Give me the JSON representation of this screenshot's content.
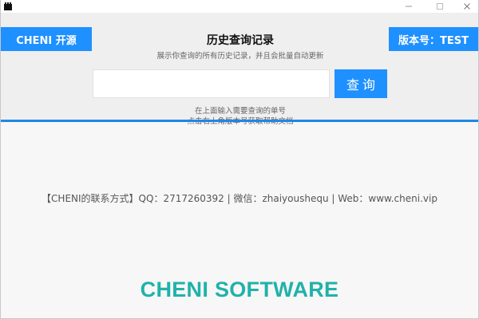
{
  "window": {
    "controls": {
      "minimize_glyph": "–",
      "maximize_glyph": "□",
      "close_glyph": "✕"
    }
  },
  "header": {
    "brand_label": "CHENI 开源",
    "version_label": "版本号：TEST",
    "title": "历史查询记录",
    "subtitle": "展示你查询的所有历史记录，并且会批量自动更新",
    "search": {
      "value": "",
      "placeholder": "",
      "button_label": "查询"
    },
    "hints": [
      "在上面输入需要查询的单号",
      "点击右上角版本号获取帮助文档"
    ]
  },
  "body": {
    "contact": "【CHENI的联系方式】QQ：2717260392 | 微信：zhaiyoushequ | Web：www.cheni.vip",
    "footer_brand": "CHENI SOFTWARE"
  },
  "colors": {
    "accent": "#1e90ff",
    "divider": "#1e88e5",
    "brand_text": "#20b2aa",
    "header_bg": "#efefef",
    "body_bg": "#f7f7f7"
  },
  "icons": {
    "app": "app-icon",
    "minimize": "minimize-icon",
    "maximize": "maximize-icon",
    "close": "close-icon"
  }
}
